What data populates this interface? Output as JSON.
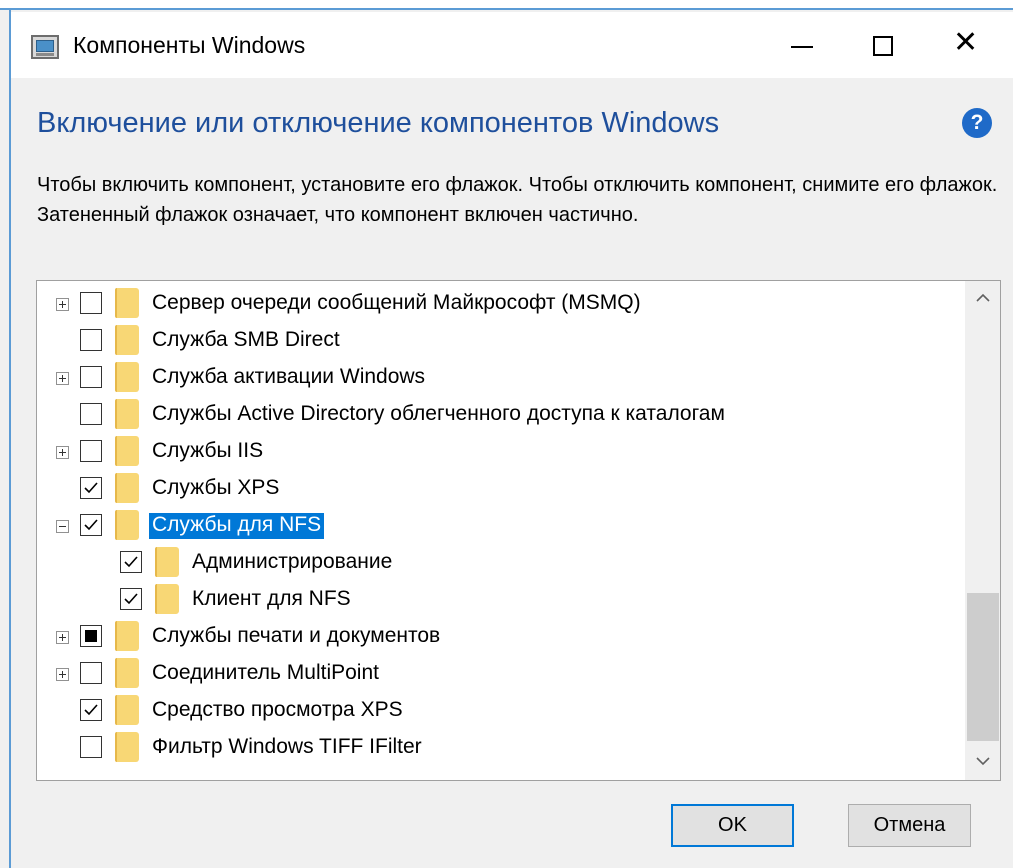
{
  "window": {
    "title": "Компоненты Windows"
  },
  "heading": "Включение или отключение компонентов Windows",
  "description": "Чтобы включить компонент, установите его флажок. Чтобы отключить компонент, снимите его флажок. Затененный флажок означает, что компонент включен частично.",
  "icons": {
    "app": "windows-features-icon",
    "help": "help-icon",
    "minimize": "minimize-icon",
    "maximize": "maximize-icon",
    "close": "close-icon",
    "help_glyph": "?",
    "close_glyph": "✕"
  },
  "colors": {
    "heading": "#1e4f9c",
    "selection": "#0078d7",
    "folder": "#f8d775",
    "help": "#1f6ac8"
  },
  "features": [
    {
      "label": "Сервер очереди сообщений Майкрософт (MSMQ)",
      "state": "unchecked",
      "expander": "plus",
      "level": 0
    },
    {
      "label": "Служба SMB Direct",
      "state": "unchecked",
      "expander": "none",
      "level": 0
    },
    {
      "label": "Служба активации Windows",
      "state": "unchecked",
      "expander": "plus",
      "level": 0
    },
    {
      "label": "Службы Active Directory облегченного доступа к каталогам",
      "state": "unchecked",
      "expander": "none",
      "level": 0
    },
    {
      "label": "Службы IIS",
      "state": "unchecked",
      "expander": "plus",
      "level": 0
    },
    {
      "label": "Службы XPS",
      "state": "checked",
      "expander": "none",
      "level": 0
    },
    {
      "label": "Службы для NFS",
      "state": "checked",
      "expander": "minus",
      "level": 0,
      "selected": true
    },
    {
      "label": "Администрирование",
      "state": "checked",
      "expander": "none",
      "level": 1
    },
    {
      "label": "Клиент для NFS",
      "state": "checked",
      "expander": "none",
      "level": 1
    },
    {
      "label": "Службы печати и документов",
      "state": "partial",
      "expander": "plus",
      "level": 0
    },
    {
      "label": "Соединитель MultiPoint",
      "state": "unchecked",
      "expander": "plus",
      "level": 0
    },
    {
      "label": "Средство просмотра XPS",
      "state": "checked",
      "expander": "none",
      "level": 0
    },
    {
      "label": "Фильтр Windows TIFF IFilter",
      "state": "unchecked",
      "expander": "none",
      "level": 0
    }
  ],
  "buttons": {
    "ok": "OK",
    "cancel": "Отмена"
  }
}
